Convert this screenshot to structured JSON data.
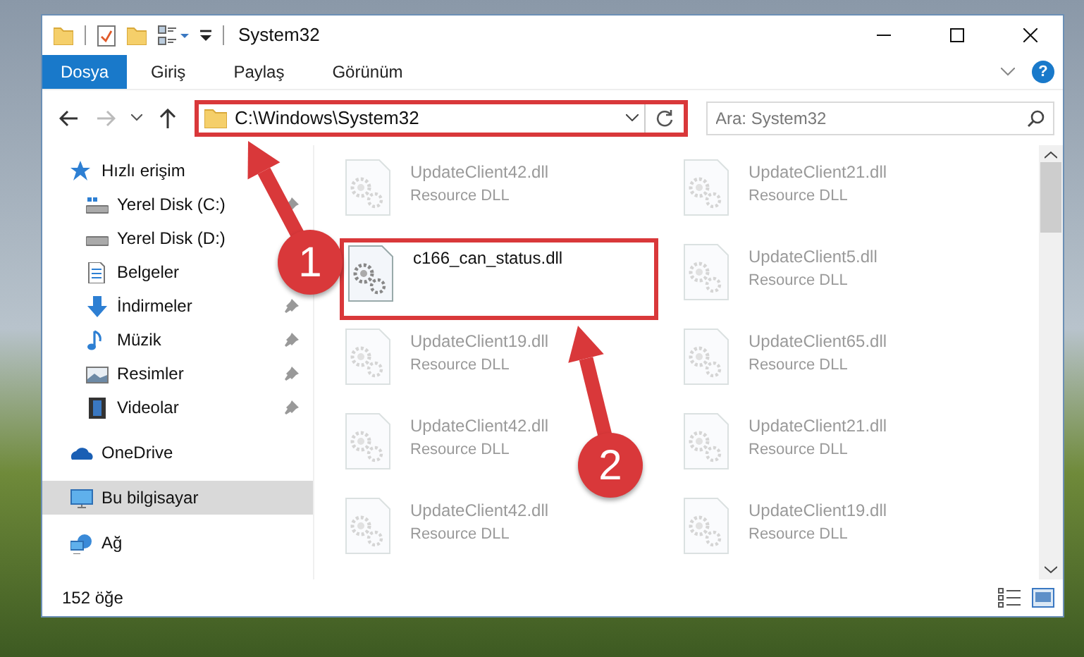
{
  "window": {
    "title": "System32"
  },
  "ribbon_tabs": [
    {
      "label": "Dosya",
      "selected": true
    },
    {
      "label": "Giriş",
      "selected": false
    },
    {
      "label": "Paylaş",
      "selected": false
    },
    {
      "label": "Görünüm",
      "selected": false
    }
  ],
  "help_button": {
    "label": "?"
  },
  "address": {
    "path": "C:\\Windows\\System32",
    "highlighted": true
  },
  "search": {
    "placeholder": "Ara: System32"
  },
  "sidebar": {
    "items": [
      {
        "label": "Hızlı erişim",
        "selected": false,
        "children": [
          {
            "label": "Yerel Disk (C:)",
            "pinned": true
          },
          {
            "label": "Yerel Disk (D:)",
            "pinned": false
          },
          {
            "label": "Belgeler",
            "pinned": false
          },
          {
            "label": "İndirmeler",
            "pinned": true
          },
          {
            "label": "Müzik",
            "pinned": true
          },
          {
            "label": "Resimler",
            "pinned": true
          },
          {
            "label": "Videolar",
            "pinned": true
          }
        ]
      },
      {
        "label": "OneDrive",
        "selected": false
      },
      {
        "label": "Bu bilgisayar",
        "selected": true
      },
      {
        "label": "Ağ",
        "selected": false
      }
    ]
  },
  "files": [
    {
      "name": "UpdateClient42.dll",
      "type": "Resource DLL",
      "faded": true,
      "highlighted": false
    },
    {
      "name": "UpdateClient21.dll",
      "type": "Resource DLL",
      "faded": true,
      "highlighted": false
    },
    {
      "name": "c166_can_status.dll",
      "faded": false,
      "highlighted": true
    },
    {
      "name": "UpdateClient5.dll",
      "type": "Resource DLL",
      "faded": true,
      "highlighted": false
    },
    {
      "name": "UpdateClient19.dll",
      "type": "Resource DLL",
      "faded": true,
      "highlighted": false
    },
    {
      "name": "UpdateClient65.dll",
      "type": "Resource DLL",
      "faded": true,
      "highlighted": false
    },
    {
      "name": "UpdateClient42.dll",
      "type": "Resource DLL",
      "faded": true,
      "highlighted": false
    },
    {
      "name": "UpdateClient21.dll",
      "type": "Resource DLL",
      "faded": true,
      "highlighted": false
    },
    {
      "name": "UpdateClient42.dll",
      "type": "Resource DLL",
      "faded": true,
      "highlighted": false
    },
    {
      "name": "UpdateClient19.dll",
      "type": "Resource DLL",
      "faded": true,
      "highlighted": false
    }
  ],
  "annotations": [
    {
      "label": "1"
    },
    {
      "label": "2"
    }
  ],
  "status_bar": {
    "count": "152 öğe"
  }
}
